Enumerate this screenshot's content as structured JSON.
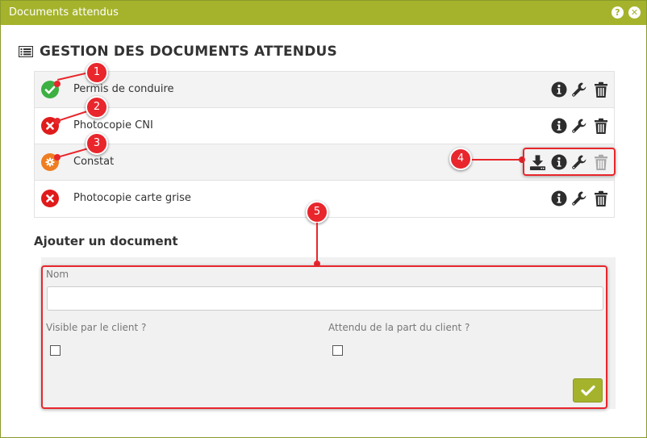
{
  "window": {
    "title": "Documents attendus",
    "help_glyph": "?",
    "close_glyph": "✕"
  },
  "heading": {
    "icon": "list-icon",
    "text": "GESTION DES DOCUMENTS ATTENDUS"
  },
  "documents": [
    {
      "label": "Permis de conduire",
      "status": "received",
      "status_icon": "check-icon"
    },
    {
      "label": "Photocopie CNI",
      "status": "missing",
      "status_icon": "cross-icon"
    },
    {
      "label": "Constat",
      "status": "pending",
      "status_icon": "cog-icon"
    },
    {
      "label": "Photocopie carte grise",
      "status": "missing",
      "status_icon": "cross-icon"
    }
  ],
  "action_icons": [
    "download-icon",
    "info-icon",
    "wrench-icon",
    "trash-icon"
  ],
  "add_form": {
    "title": "Ajouter un document",
    "name_label": "Nom",
    "name_value": "",
    "visible_label": "Visible par le client ?",
    "visible_checked": false,
    "expected_label": "Attendu de la part du client ?",
    "expected_checked": false,
    "submit_icon": "check-icon"
  },
  "annotations": [
    "1",
    "2",
    "3",
    "4",
    "5"
  ],
  "colors": {
    "accent": "#a5b32c",
    "status_ok": "#3cb043",
    "status_missing": "#e01b1b",
    "status_pending": "#ef7d22",
    "annotation": "#e8262c"
  }
}
